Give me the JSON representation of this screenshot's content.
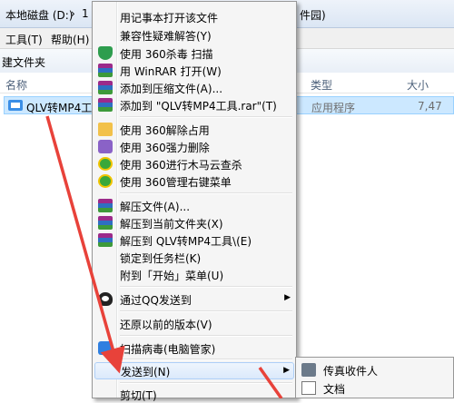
{
  "address": {
    "drive": "本地磁盘 (D:)",
    "sep": "›",
    "part": "1",
    "tail": "件园)"
  },
  "menubar": {
    "tools": "工具(T)",
    "help": "帮助(H)"
  },
  "toolbar": {
    "new_folder": "建文件夹"
  },
  "columns": {
    "name": "名称",
    "type": "类型",
    "size": "大小"
  },
  "file": {
    "name": "QLV转MP4工具",
    "type": "应用程序",
    "size": "7,47"
  },
  "context_menu": {
    "items": [
      {
        "label": "用记事本打开该文件",
        "icon": ""
      },
      {
        "label": "兼容性疑难解答(Y)",
        "icon": ""
      },
      {
        "label": "使用 360杀毒 扫描",
        "icon": "shield-icon"
      },
      {
        "label": "用 WinRAR 打开(W)",
        "icon": "winrar-icon"
      },
      {
        "label": "添加到压缩文件(A)...",
        "icon": "winrar-icon"
      },
      {
        "label": "添加到 \"QLV转MP4工具.rar\"(T)",
        "icon": "winrar-icon"
      },
      {
        "label": "使用 360解除占用",
        "icon": "folder-icon"
      },
      {
        "label": "使用 360强力删除",
        "icon": "purple-icon"
      },
      {
        "label": "使用 360进行木马云查杀",
        "icon": "360-icon"
      },
      {
        "label": "使用 360管理右键菜单",
        "icon": "360-icon"
      },
      {
        "label": "解压文件(A)...",
        "icon": "winrar-icon"
      },
      {
        "label": "解压到当前文件夹(X)",
        "icon": "winrar-icon"
      },
      {
        "label": "解压到 QLV转MP4工具\\(E)",
        "icon": "winrar-icon"
      },
      {
        "label": "锁定到任务栏(K)",
        "icon": ""
      },
      {
        "label": "附到「开始」菜单(U)",
        "icon": ""
      },
      {
        "label": "通过QQ发送到",
        "icon": "qq-icon",
        "submenu": true
      },
      {
        "label": "还原以前的版本(V)",
        "icon": ""
      },
      {
        "label": "扫描病毒(电脑管家)",
        "icon": "pc-manager-icon"
      },
      {
        "label": "发送到(N)",
        "icon": "",
        "submenu": true,
        "highlighted": true
      },
      {
        "label": "剪切(T)",
        "icon": ""
      }
    ]
  },
  "submenu": {
    "items": [
      {
        "label": "传真收件人",
        "icon": "fax-icon"
      },
      {
        "label": "文档",
        "icon": "document-icon"
      }
    ]
  },
  "arrow_color": "#e8423a"
}
